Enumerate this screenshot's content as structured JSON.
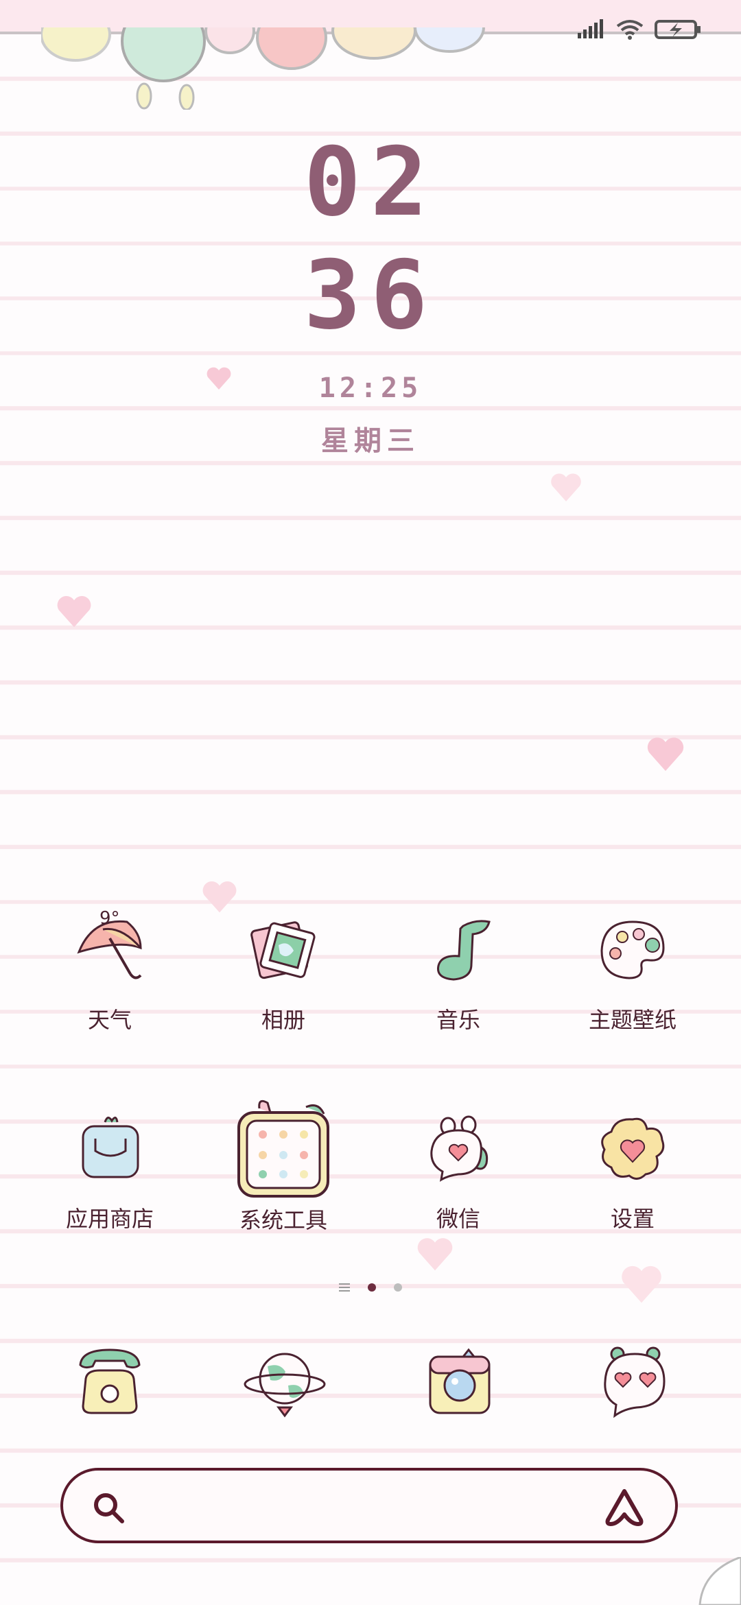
{
  "status_bar": {
    "icons": [
      "signal-icon",
      "wifi-icon",
      "battery-charging-icon"
    ]
  },
  "clock": {
    "hour": "02",
    "minute": "36",
    "secondary_time": "12:25",
    "weekday": "星期三"
  },
  "weather": {
    "temperature": "9°"
  },
  "apps_row1": [
    {
      "label": "天气",
      "icon": "umbrella-icon"
    },
    {
      "label": "相册",
      "icon": "photo-frame-icon"
    },
    {
      "label": "音乐",
      "icon": "music-note-icon"
    },
    {
      "label": "主题壁纸",
      "icon": "palette-icon"
    }
  ],
  "apps_row2": [
    {
      "label": "应用商店",
      "icon": "shopping-bag-icon"
    },
    {
      "label": "系统工具",
      "icon": "folder-icon"
    },
    {
      "label": "微信",
      "icon": "chat-bunny-icon"
    },
    {
      "label": "设置",
      "icon": "flower-gear-icon"
    }
  ],
  "page_indicator": {
    "pages": 2,
    "active": 1
  },
  "dock": [
    "phone-icon",
    "globe-icon",
    "camera-icon",
    "messages-icon"
  ],
  "colors": {
    "clock": "#8f5e74",
    "accent": "#5b1a2c",
    "heart": "#f7c9d6"
  }
}
